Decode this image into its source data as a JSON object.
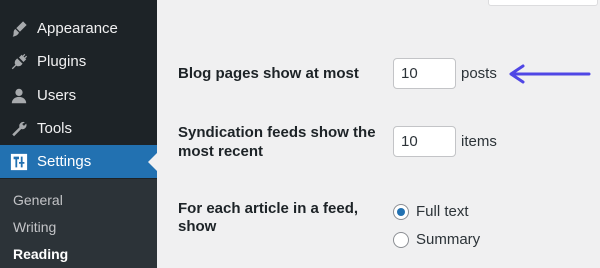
{
  "sidebar": {
    "items": [
      {
        "label": "Appearance",
        "icon": "paintbrush-icon"
      },
      {
        "label": "Plugins",
        "icon": "plugin-icon"
      },
      {
        "label": "Users",
        "icon": "users-icon"
      },
      {
        "label": "Tools",
        "icon": "wrench-icon"
      },
      {
        "label": "Settings",
        "icon": "settings-icon",
        "active": true
      }
    ],
    "submenu": [
      {
        "label": "General"
      },
      {
        "label": "Writing"
      },
      {
        "label": "Reading",
        "current": true
      }
    ]
  },
  "settings": {
    "blog_pages": {
      "label": "Blog pages show at most",
      "value": "10",
      "unit": "posts"
    },
    "syndication": {
      "label_line1": "Syndication feeds show the",
      "label_line2": "most recent",
      "value": "10",
      "unit": "items"
    },
    "feed_article": {
      "label_line1": "For each article in a feed,",
      "label_line2": "show",
      "options": [
        {
          "label": "Full text",
          "selected": true
        },
        {
          "label": "Summary",
          "selected": false
        }
      ]
    }
  },
  "colors": {
    "sidebar_bg": "#1d2327",
    "active_bg": "#2271b1",
    "arrow": "#4f46e5"
  }
}
